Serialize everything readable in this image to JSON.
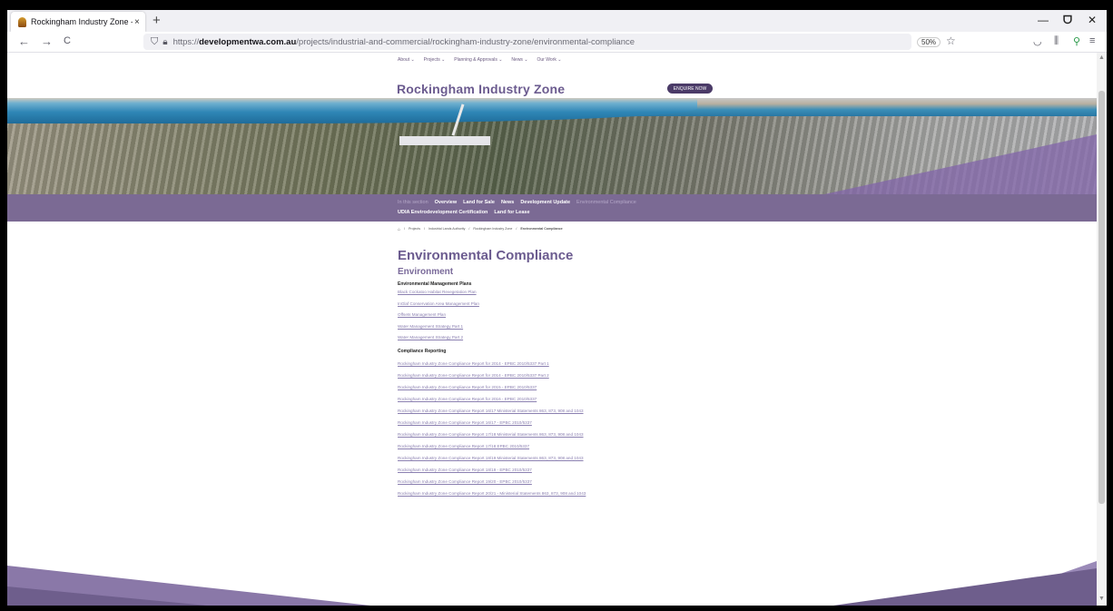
{
  "browser": {
    "tab_title": "Rockingham Industry Zone - En",
    "tab_close": "×",
    "new_tab": "+",
    "url_prefix": "https://",
    "url_domain": "developmentwa.com.au",
    "url_path": "/projects/industrial-and-commercial/rockingham-industry-zone/environmental-compliance",
    "zoom": "50%",
    "back": "←",
    "forward": "→",
    "reload": "C",
    "minimize": "—",
    "maximize": "ᗜ",
    "close": "✕"
  },
  "site_nav": [
    "About ⌄",
    "Projects ⌄",
    "Planning & Approvals ⌄",
    "News ⌄",
    "Our Work ⌄"
  ],
  "site": {
    "title": "Rockingham Industry Zone",
    "enquire": "ENQUIRE NOW"
  },
  "subnav": {
    "in_this_section": "In this section",
    "row1": [
      "Overview",
      "Land for Sale",
      "News",
      "Development Update"
    ],
    "current": "Environmental Compliance",
    "row2": [
      "UDIA Envirodevelopment Certification",
      "Land for Lease"
    ]
  },
  "breadcrumb": [
    "Projects",
    "/",
    "Industrial Lands Authority",
    "/",
    "Rockingham Industry Zone",
    "/",
    "Environmental Compliance"
  ],
  "content": {
    "page_title": "Environmental Compliance",
    "section_title": "Environment",
    "emp_heading": "Environmental Management Plans",
    "emp_links": [
      "Black Cockatoo Habitat Revegetation Plan",
      "InGlaf Conservation Area Management Plan",
      "Offsets Management Plan",
      "Water Management Strategy Part 1",
      "Water Management Strategy Part 2"
    ],
    "cr_heading": "Compliance Reporting",
    "cr_links": [
      "Rockingham Industry Zone Compliance Report for 2014 - EPBC 2010/5337 Part 1",
      "Rockingham Industry Zone Compliance Report for 2014 - EPBC 2010/5337 Part 2",
      "Rockingham Industry Zone Compliance Report for 2015 - EPBC 2010/5337",
      "Rockingham Industry Zone Compliance Report for 2016 - EPBC 2010/5337",
      "Rockingham Industry Zone Compliance Report 16/17 Ministerial Statements 863, 873, 908 and 1043",
      "Rockingham Industry Zone Compliance Report 16/17 - EPBC 2010/5337",
      "Rockingham Industry Zone Compliance Report 17/18 Ministerial Statements 863, 873, 908 and 1043",
      "Rockingham Industry Zone Compliance Report 17/18 EPBC 2010/5337",
      "Rockingham Industry Zone Compliance Report 18/19 Ministerial Statements 863, 873, 908 and 1043",
      "Rockingham Industry Zone Compliance Report 18/19 - EPBC 2010/5337",
      "Rockingham Industry Zone Compliance Report 19/20 - EPBC 2010/5337",
      "Rockingham Industry Zone Compliance Report 20/21 - Ministerial Statements 863, 873, 908 and 1043"
    ]
  },
  "colors": {
    "brand_purple": "#6b5b8f",
    "subnav_bg": "#7b6a94",
    "link": "#8a7fb0"
  }
}
